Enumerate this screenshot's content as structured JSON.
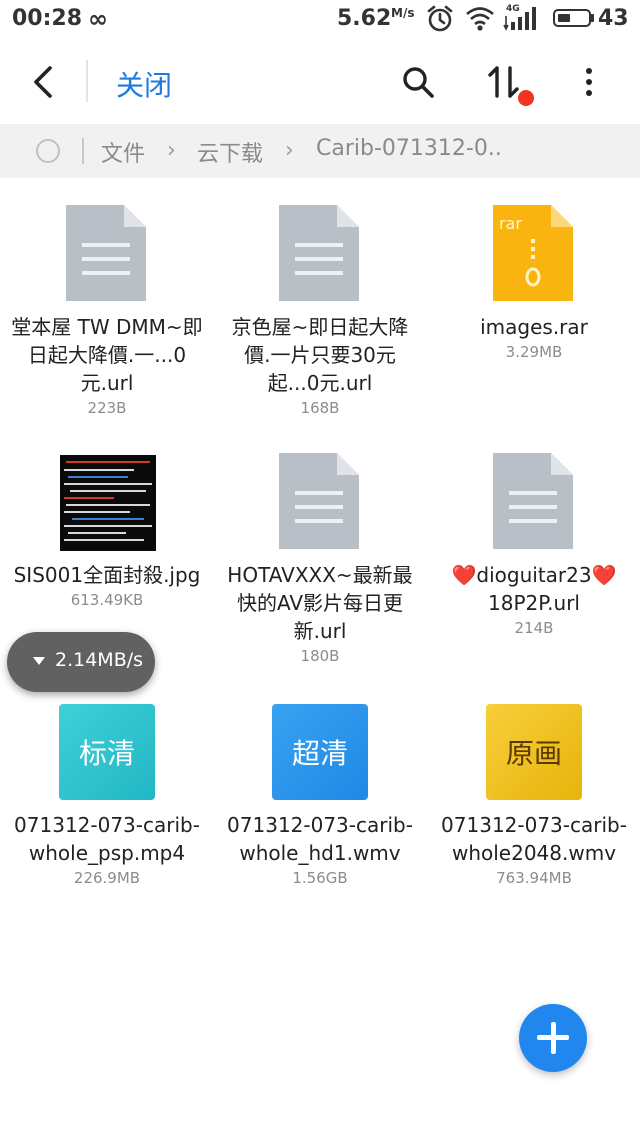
{
  "status_bar": {
    "time": "00:28",
    "loop_glyph": "∞",
    "net_speed": "5.62",
    "net_speed_unit": "M/s",
    "network_type": "4G",
    "battery_level": "43",
    "icons": [
      "alarm-icon",
      "wifi-icon",
      "signal-icon",
      "battery-icon"
    ]
  },
  "appbar": {
    "close_label": "关闭",
    "accent_color": "#1e7ae0",
    "sort_badge_color": "#f2331f"
  },
  "breadcrumb": {
    "items": [
      "文件",
      "云下载",
      "Carib-071312-0.."
    ]
  },
  "files": [
    {
      "name": "堂本屋 TW DMM~即日起大降價.一...0元.url",
      "size": "223B",
      "icon": "url-file-icon"
    },
    {
      "name": "京色屋~即日起大降價.一片只要30元起...0元.url",
      "size": "168B",
      "icon": "url-file-icon"
    },
    {
      "name": "images.rar",
      "size": "3.29MB",
      "icon": "rar-file-icon",
      "badge": "rar"
    },
    {
      "name": "SIS001全面封殺.jpg",
      "size": "613.49KB",
      "icon": "image-thumbnail"
    },
    {
      "name": "HOTAVXXX~最新最快的AV影片每日更新.url",
      "size": "180B",
      "icon": "url-file-icon"
    },
    {
      "name": "❤️dioguitar23❤️18P2P.url",
      "size": "214B",
      "icon": "url-file-icon"
    },
    {
      "name": "071312-073-carib-whole_psp.mp4",
      "size": "226.9MB",
      "icon": "video-sd-icon",
      "badge": "标清"
    },
    {
      "name": "071312-073-carib-whole_hd1.wmv",
      "size": "1.56GB",
      "icon": "video-hd-icon",
      "badge": "超清"
    },
    {
      "name": "071312-073-carib-whole2048.wmv",
      "size": "763.94MB",
      "icon": "video-original-icon",
      "badge": "原画"
    }
  ],
  "download_indicator": {
    "speed": "2.14MB/s"
  },
  "fab": {
    "icon": "plus-icon",
    "color": "#2186ee"
  }
}
